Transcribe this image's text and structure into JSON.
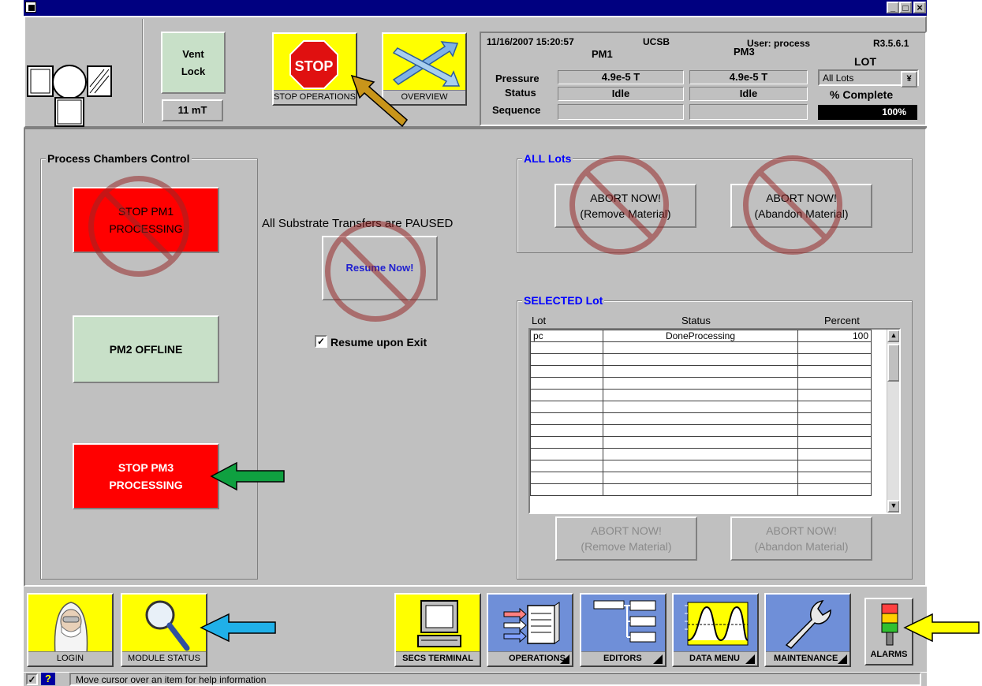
{
  "header": {
    "datetime": "11/16/2007  15:20:57",
    "site": "UCSB",
    "user": "User: process",
    "version": "R3.5.6.1",
    "vent_lock": {
      "line1": "Vent",
      "line2": "Lock",
      "pressure": "11 mT"
    },
    "stop_ops": {
      "icon_text": "STOP",
      "caption": "STOP OPERATIONS"
    },
    "overview": {
      "caption": "OVERVIEW"
    },
    "window_buttons": {
      "minimize": "_",
      "maximize": "□",
      "close": "×"
    }
  },
  "status_panel": {
    "col_pm1": "PM1",
    "col_pm3": "PM3",
    "col_lot": "LOT",
    "row_pressure": "Pressure",
    "row_status": "Status",
    "row_sequence": "Sequence",
    "pm1_pressure": "4.9e-5  T",
    "pm3_pressure": "4.9e-5  T",
    "pm1_status": "Idle",
    "pm3_status": "Idle",
    "pm1_sequence": "",
    "pm3_sequence": "",
    "lot_select": "All Lots",
    "lot_select_arrow": "¥",
    "percent_label": "% Complete",
    "percent_value": "100%"
  },
  "chambers": {
    "title": "Process Chambers Control",
    "pm1_line1": "STOP PM1",
    "pm1_line2": "PROCESSING",
    "pm2": "PM2 OFFLINE",
    "pm3_line1": "STOP PM3",
    "pm3_line2": "PROCESSING"
  },
  "transfers": {
    "paused_text": "All Substrate Transfers are PAUSED",
    "resume_btn": "Resume Now!",
    "resume_checkbox_mark": "✓",
    "resume_exit": "Resume upon Exit"
  },
  "all_lots": {
    "title": "ALL Lots",
    "abort_remove_1": "ABORT NOW!",
    "abort_remove_2": "(Remove Material)",
    "abort_abandon_1": "ABORT NOW!",
    "abort_abandon_2": "(Abandon Material)"
  },
  "selected_lot": {
    "title": "SELECTED Lot",
    "col_lot": "Lot",
    "col_status": "Status",
    "col_percent": "Percent",
    "rows": [
      {
        "lot": "pc",
        "status": "DoneProcessing",
        "percent": "100"
      }
    ],
    "abort_remove_1": "ABORT NOW!",
    "abort_remove_2": "(Remove Material)",
    "abort_abandon_1": "ABORT NOW!",
    "abort_abandon_2": "(Abandon Material)"
  },
  "toolbar": {
    "login": "LOGIN",
    "module_status": "MODULE STATUS",
    "secs_terminal": "SECS TERMINAL",
    "operations": "OPERATIONS",
    "editors": "EDITORS",
    "data_menu": "DATA MENU",
    "maintenance": "MAINTENANCE",
    "alarms": "ALARMS"
  },
  "statusbar": {
    "check": "✓",
    "help_icon_text": "?",
    "help": "Move cursor over an item for help information"
  },
  "colors": {
    "stop_red": "#ff0000",
    "yellow": "#ffff00",
    "blue_btn": "#6f8fd8",
    "pm2_green": "#c8e0c8"
  }
}
